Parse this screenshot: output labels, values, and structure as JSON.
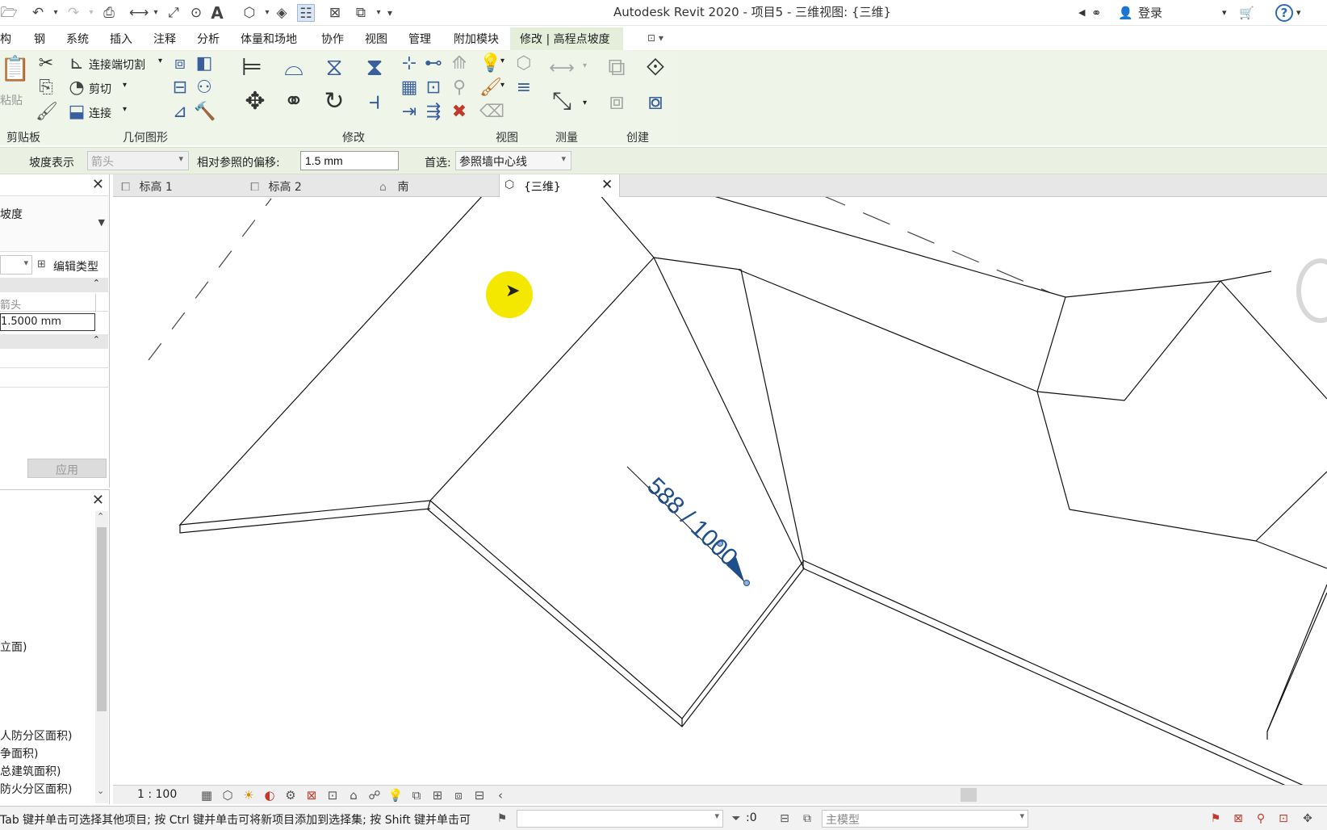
{
  "app": {
    "title": "Autodesk Revit 2020 - 项目5 - 三维视图: {三维}",
    "login_label": "登录",
    "help_label": "?"
  },
  "ribbon": {
    "tabs": [
      "构",
      "钢",
      "系统",
      "插入",
      "注释",
      "分析",
      "体量和场地",
      "协作",
      "视图",
      "管理",
      "附加模块",
      "修改 | 高程点坡度"
    ],
    "active_tab": "修改 | 高程点坡度",
    "panels": {
      "clipboard": "剪贴板",
      "geometry": "几何图形",
      "modify": "修改",
      "view": "视图",
      "measure": "测量",
      "create": "创建"
    },
    "buttons": {
      "paste": "粘贴",
      "cope": "连接端切割",
      "cut": "剪切",
      "join": "连接"
    }
  },
  "options_bar": {
    "slope_label": "坡度表示",
    "slope_value": "箭头",
    "offset_label": "相对参照的偏移:",
    "offset_value": "1.5 mm",
    "prefer_label": "首选:",
    "prefer_value": "参照墙中心线"
  },
  "properties": {
    "type_name": "坡度",
    "edit_type_label": "编辑类型",
    "row_arrow": "箭头",
    "row_offset": "1.5000 mm",
    "apply_label": "应用"
  },
  "project_browser": {
    "items": [
      "立面)",
      "人防分区面积)",
      "争面积)",
      "总建筑面积)",
      "防火分区面积)"
    ]
  },
  "view_tabs": [
    {
      "label": "标高 1"
    },
    {
      "label": "标高 2"
    },
    {
      "label": "南"
    },
    {
      "label": "{三维}"
    }
  ],
  "annotation": {
    "slope_text": "588 / 1000"
  },
  "view_control": {
    "scale": "1 : 100"
  },
  "status_bar": {
    "hint": "Tab 键并单击可选择其他项目; 按 Ctrl 键并单击可将新项目添加到选择集; 按 Shift 键并单击可",
    "selection_count": ":0",
    "model_label": "主模型"
  },
  "colors": {
    "ribbon_bg": "#eff5e8",
    "annotation_blue": "#1f4e8c",
    "cursor_highlight": "#f5e800"
  }
}
